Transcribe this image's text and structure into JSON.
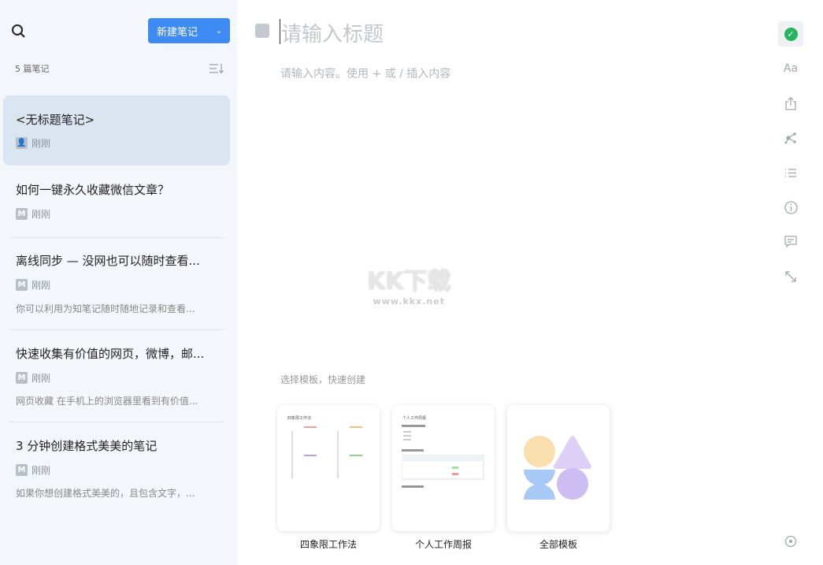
{
  "sidebar": {
    "new_note_label": "新建笔记",
    "note_count": "5 篇笔记",
    "notes": [
      {
        "title": "<无标题笔记>",
        "time": "刚刚",
        "snippet": "",
        "icon": "people-icon"
      },
      {
        "title": "如何一键永久收藏微信文章？",
        "time": "刚刚",
        "snippet": "",
        "icon": "markdown-icon"
      },
      {
        "title": "离线同步 — 没网也可以随时查看...",
        "time": "刚刚",
        "snippet": "你可以利用为知笔记随时随地记录和查看...",
        "icon": "markdown-icon"
      },
      {
        "title": "快速收集有价值的网页，微博，邮...",
        "time": "刚刚",
        "snippet": "网页收藏 在手机上的浏览器里看到有价值...",
        "icon": "markdown-icon"
      },
      {
        "title": "3 分钟创建格式美美的笔记",
        "time": "刚刚",
        "snippet": "如果你想创建格式美美的，且包含文字，...",
        "icon": "markdown-icon"
      }
    ]
  },
  "editor": {
    "title_placeholder": "请输入标题",
    "body_placeholder": "请输入内容。使用 + 或 / 插入内容",
    "template_prompt": "选择模板，快速创建",
    "templates": [
      {
        "label": "四象限工作法",
        "preview_title": "四象限工作法"
      },
      {
        "label": "个人工作周报",
        "preview_title": "个人工作周报"
      },
      {
        "label": "全部模板"
      }
    ]
  },
  "watermark": {
    "logo": "KK下载",
    "url": "www.kkx.net"
  },
  "right_toolbar": [
    "check-icon",
    "font-icon",
    "share-icon",
    "graph-icon",
    "outline-icon",
    "info-icon",
    "comment-icon",
    "expand-icon"
  ],
  "right_toolbar_font_label": "Aa",
  "colors": {
    "accent": "#3d8bf3",
    "success": "#27b461"
  }
}
